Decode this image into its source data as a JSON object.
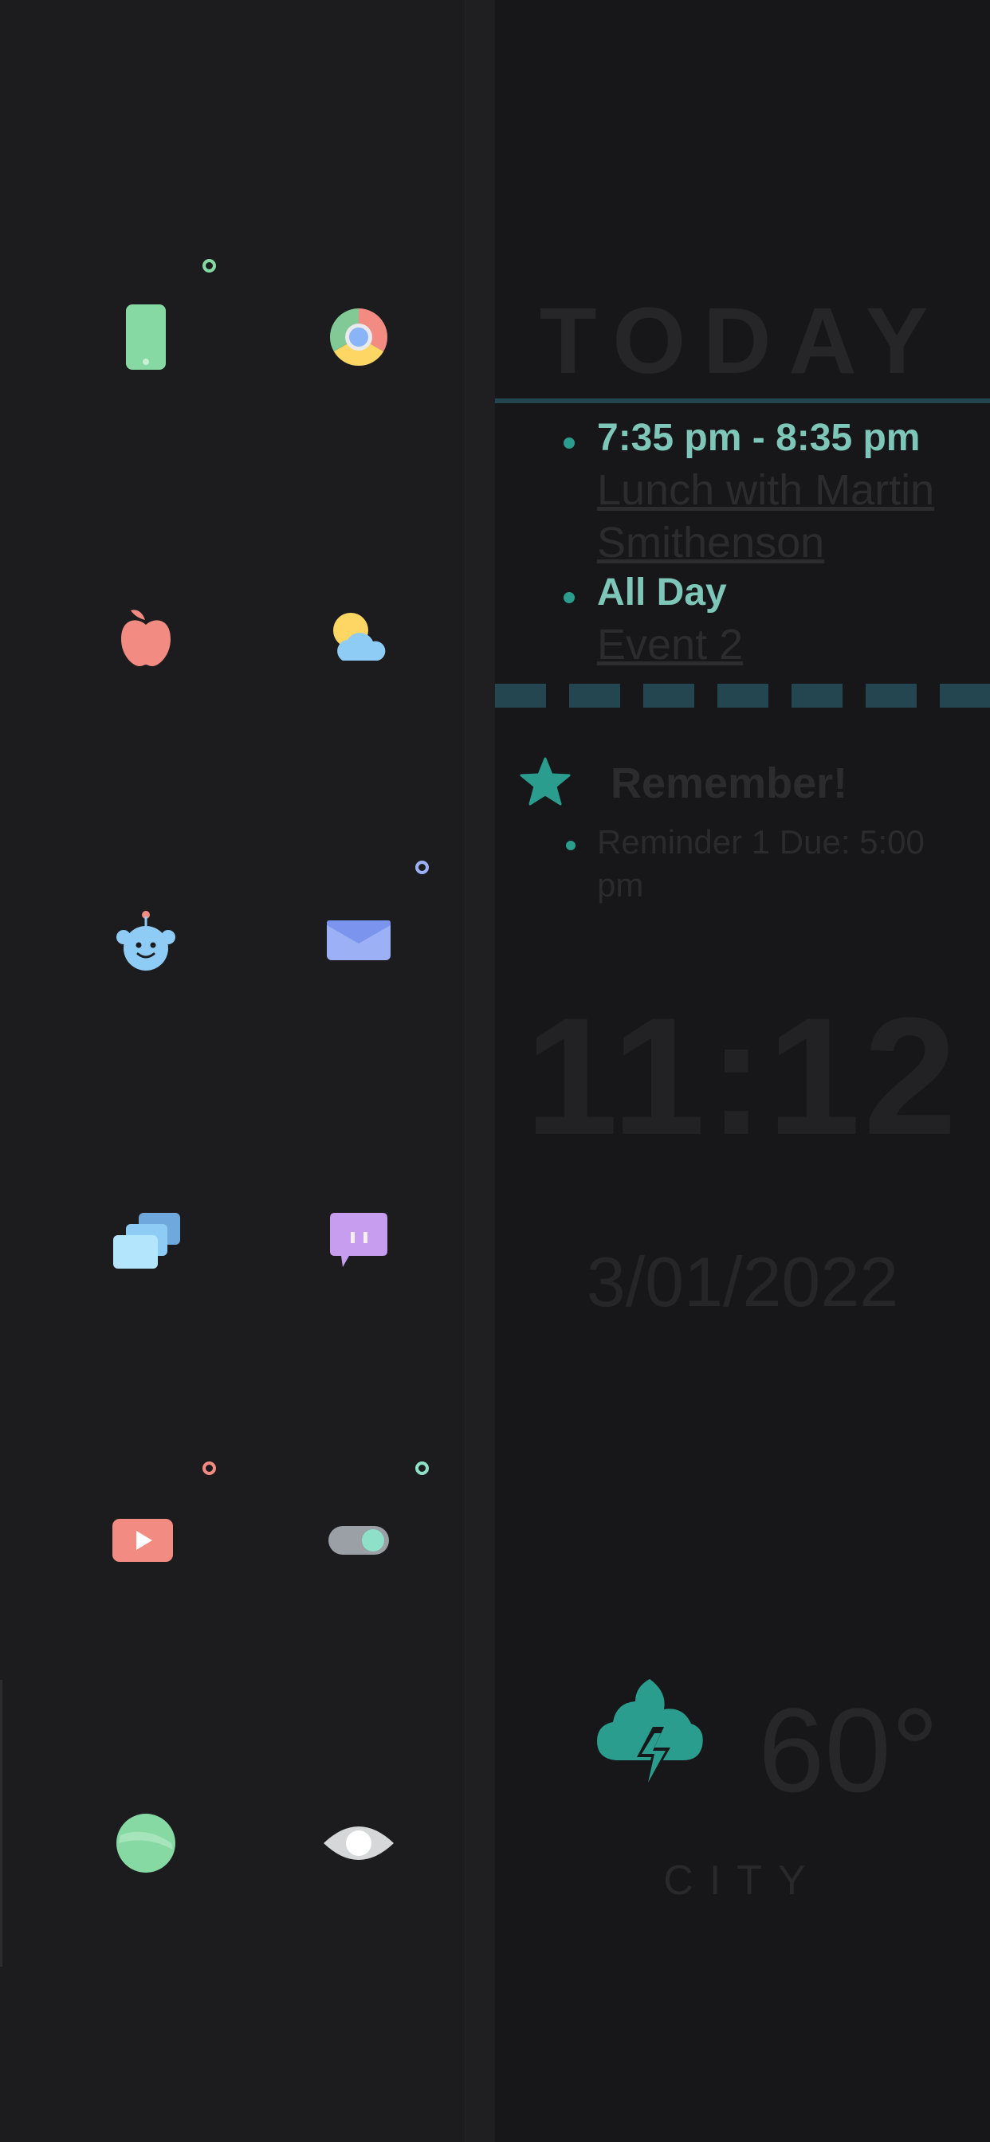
{
  "apps": [
    {
      "name": "phone-app-icon",
      "color": "#86d9a3"
    },
    {
      "name": "chrome-app-icon",
      "color": "#f28b82"
    },
    {
      "name": "apple-app-icon",
      "color": "#f28b82"
    },
    {
      "name": "weather-app-icon",
      "color": "#8ecbf5"
    },
    {
      "name": "reddit-app-icon",
      "color": "#8ecbf5"
    },
    {
      "name": "mail-app-icon",
      "color": "#9bb0f5"
    },
    {
      "name": "messages-app-icon",
      "color": "#8ecbf5"
    },
    {
      "name": "chat-app-icon",
      "color": "#c79df0"
    },
    {
      "name": "youtube-app-icon",
      "color": "#f28b82"
    },
    {
      "name": "toggle-app-icon",
      "color": "#8ee0c8"
    },
    {
      "name": "globe-app-icon",
      "color": "#86d9a3"
    },
    {
      "name": "eye-app-icon",
      "color": "#e0e0e0"
    }
  ],
  "widget": {
    "today_title": "TODAY",
    "events": [
      {
        "time": "7:35 pm - 8:35 pm",
        "title": "Lunch with Martin Smithenson"
      },
      {
        "time": "All Day",
        "title": "Event 2"
      }
    ],
    "reminders_title": "Remember!",
    "reminders": [
      "Reminder 1 Due: 5:00 pm"
    ],
    "clock": "11:12",
    "date": "3/01/2022",
    "temperature": "60°",
    "city": "CITY"
  },
  "colors": {
    "accent": "#2a9d8f",
    "accent_text": "#7ec6b8",
    "rule": "#234650"
  }
}
